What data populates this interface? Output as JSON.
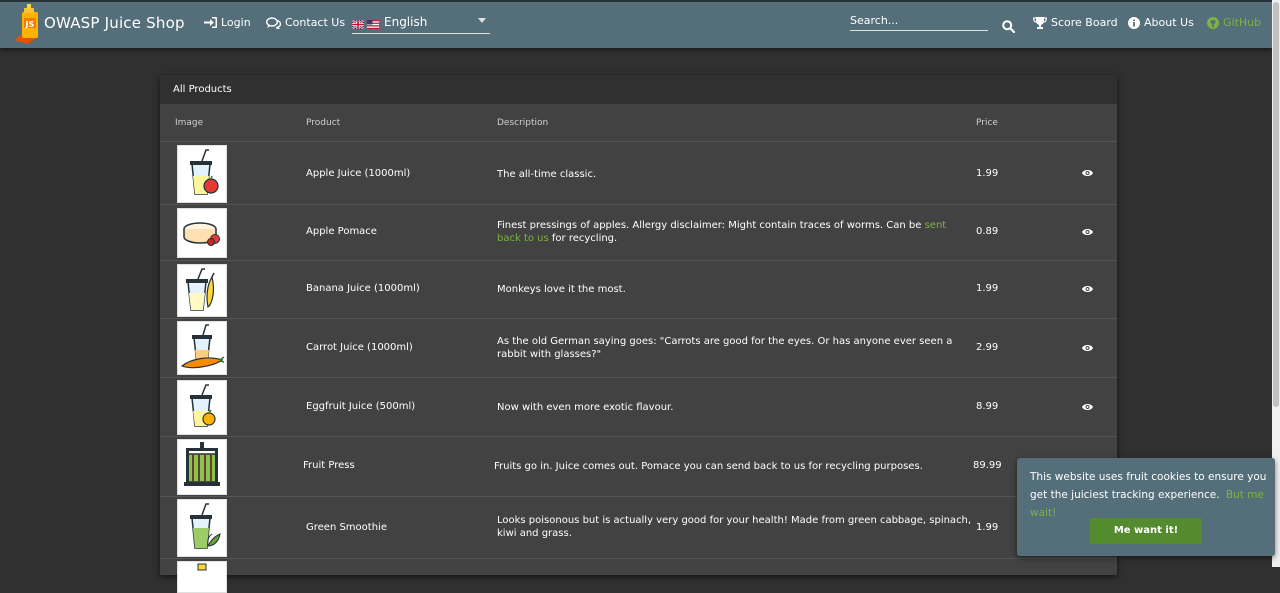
{
  "header": {
    "brand": "OWASP Juice Shop",
    "login": "Login",
    "contact": "Contact Us",
    "language": "English",
    "search_placeholder": "Search...",
    "score_board": "Score Board",
    "about": "About Us",
    "github": "GitHub"
  },
  "table": {
    "title": "All Products",
    "columns": {
      "image": "Image",
      "product": "Product",
      "description": "Description",
      "price": "Price"
    },
    "rows": [
      {
        "name": "Apple Juice (1000ml)",
        "desc": "The all-time classic.",
        "price": "1.99",
        "icon": "apple-juice-icon"
      },
      {
        "name": "Apple Pomace",
        "desc_pre": "Finest pressings of apples. Allergy disclaimer: Might contain traces of worms. Can be ",
        "desc_link": "sent back to us",
        "desc_post": " for recycling.",
        "price": "0.89",
        "icon": "apple-pomace-icon"
      },
      {
        "name": "Banana Juice (1000ml)",
        "desc": "Monkeys love it the most.",
        "price": "1.99",
        "icon": "banana-juice-icon"
      },
      {
        "name": "Carrot Juice (1000ml)",
        "desc": "As the old German saying goes: \"Carrots are good for the eyes. Or has anyone ever seen a rabbit with glasses?\"",
        "price": "2.99",
        "icon": "carrot-juice-icon"
      },
      {
        "name": "Eggfruit Juice (500ml)",
        "desc": "Now with even more exotic flavour.",
        "price": "8.99",
        "icon": "eggfruit-juice-icon"
      },
      {
        "name": "Fruit Press",
        "desc": "Fruits go in. Juice comes out. Pomace you can send back to us for recycling purposes.",
        "price": "89.99",
        "icon": "fruit-press-icon"
      },
      {
        "name": "Green Smoothie",
        "desc": "Looks poisonous but is actually very good for your health! Made from green cabbage, spinach, kiwi and grass.",
        "price": "1.99",
        "icon": "green-smoothie-icon"
      }
    ]
  },
  "cookie": {
    "message": "This website uses fruit cookies to ensure you get the juiciest tracking experience.",
    "link": "But me wait!",
    "button": "Me want it!"
  },
  "colors": {
    "toolbar": "#546e7a",
    "accent_green": "#7cb342",
    "button_green": "#558b2f",
    "background": "#303030",
    "card": "#424242"
  }
}
